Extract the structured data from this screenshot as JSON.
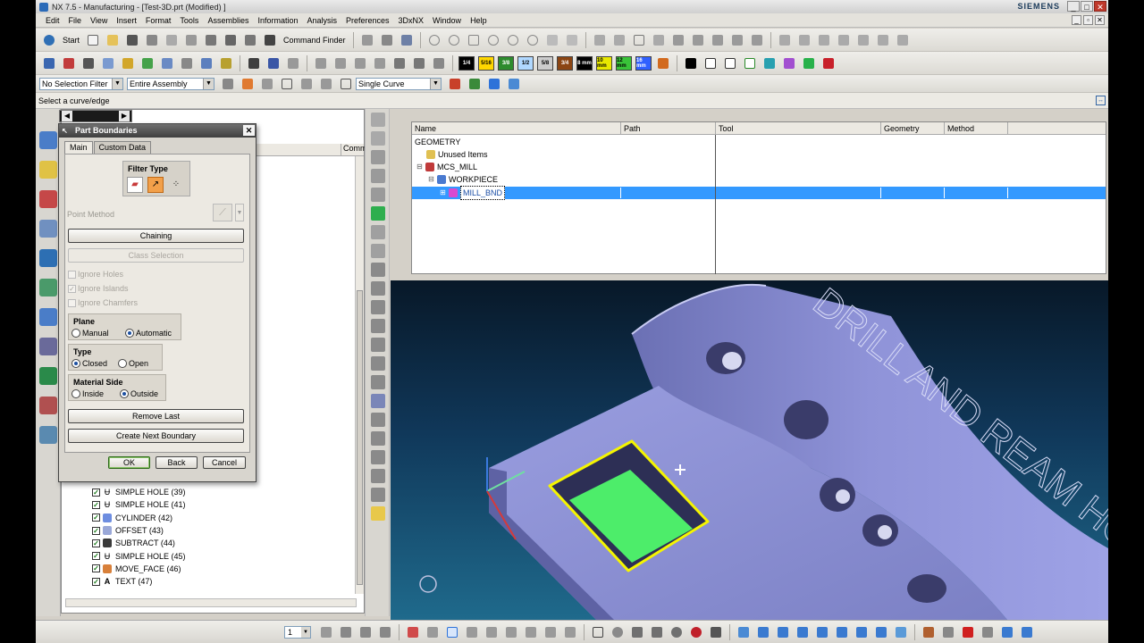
{
  "window": {
    "title": "NX 7.5 - Manufacturing - [Test-3D.prt (Modified) ]",
    "brand": "SIEMENS"
  },
  "menu": [
    "Edit",
    "File",
    "View",
    "Insert",
    "Format",
    "Tools",
    "Assemblies",
    "Information",
    "Analysis",
    "Preferences",
    "3DxNX",
    "Window",
    "Help"
  ],
  "toolbar1": {
    "start_label": "Start",
    "command_finder_label": "Command Finder"
  },
  "layers": [
    "1/4",
    "5/16",
    "3/8",
    "1/2",
    "5/8",
    "3/4",
    "8 mm",
    "10 mm",
    "12 mm",
    "16 mm"
  ],
  "layer_colors": [
    "#000000",
    "#ffd700",
    "#2e8b2e",
    "#b0d8ff",
    "#cccccc",
    "#8b4513",
    "#000000",
    "#e8e800",
    "#39c339",
    "#3060ff",
    "#d26a1e"
  ],
  "selection_bar": {
    "filter": "No Selection Filter",
    "scope": "Entire Assembly",
    "curve_rule": "Single Curve"
  },
  "status": {
    "prompt": "Select a curve/edge"
  },
  "part_navigator": {
    "comment_header": "Comm",
    "items": [
      {
        "label": "SIMPLE HOLE (39)",
        "icon": "hole-icon"
      },
      {
        "label": "SIMPLE HOLE (41)",
        "icon": "hole-icon"
      },
      {
        "label": "CYLINDER (42)",
        "icon": "cylinder-icon"
      },
      {
        "label": "OFFSET (43)",
        "icon": "offset-icon"
      },
      {
        "label": "SUBTRACT (44)",
        "icon": "subtract-icon"
      },
      {
        "label": "SIMPLE HOLE (45)",
        "icon": "hole-icon"
      },
      {
        "label": "MOVE_FACE (46)",
        "icon": "move-face-icon"
      },
      {
        "label": "TEXT (47)",
        "icon": "text-icon"
      }
    ]
  },
  "dialog": {
    "title": "Part Boundaries",
    "tabs": [
      "Main",
      "Custom Data"
    ],
    "filter_type_label": "Filter Type",
    "point_method_label": "Point Method",
    "chaining_label": "Chaining",
    "class_selection_label": "Class Selection",
    "ignore_holes": "Ignore Holes",
    "ignore_islands": "Ignore Islands",
    "ignore_chamfers": "Ignore Chamfers",
    "plane": {
      "label": "Plane",
      "options": [
        "Manual",
        "Automatic"
      ],
      "selected": "Automatic"
    },
    "type": {
      "label": "Type",
      "options": [
        "Closed",
        "Open"
      ],
      "selected": "Closed"
    },
    "material_side": {
      "label": "Material Side",
      "options": [
        "Inside",
        "Outside"
      ],
      "selected": "Outside"
    },
    "remove_last_label": "Remove Last",
    "create_next_label": "Create Next Boundary",
    "ok_label": "OK",
    "back_label": "Back",
    "cancel_label": "Cancel"
  },
  "operation_navigator": {
    "columns": [
      "Name",
      "Path",
      "Tool",
      "Geometry",
      "Method"
    ],
    "rows": [
      {
        "name": "GEOMETRY",
        "indent": 0
      },
      {
        "name": "Unused Items",
        "indent": 1
      },
      {
        "name": "MCS_MILL",
        "indent": 1
      },
      {
        "name": "WORKPIECE",
        "indent": 2
      },
      {
        "name": "MILL_BND",
        "indent": 3,
        "selected": true
      }
    ]
  },
  "viewport": {
    "engraved_text": "DRILL AND REAM HOLES",
    "model_color": "#8a8ed6",
    "boundary_color": "#f5f500",
    "pocket_color": "#4ded6a"
  },
  "bottom_bar": {
    "spinner_value": "1"
  }
}
